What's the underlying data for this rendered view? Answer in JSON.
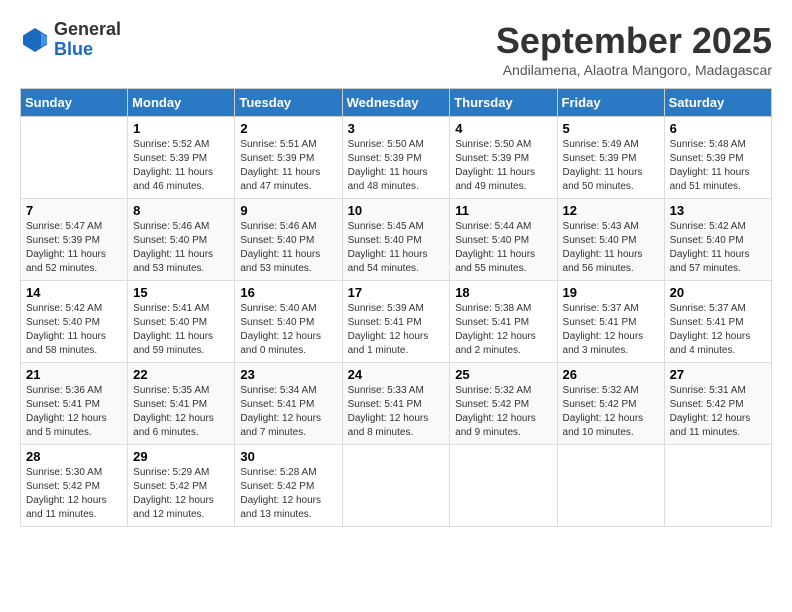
{
  "logo": {
    "general": "General",
    "blue": "Blue"
  },
  "title": "September 2025",
  "subtitle": "Andilamena, Alaotra Mangoro, Madagascar",
  "headers": [
    "Sunday",
    "Monday",
    "Tuesday",
    "Wednesday",
    "Thursday",
    "Friday",
    "Saturday"
  ],
  "weeks": [
    [
      {
        "day": "",
        "info": ""
      },
      {
        "day": "1",
        "info": "Sunrise: 5:52 AM\nSunset: 5:39 PM\nDaylight: 11 hours\nand 46 minutes."
      },
      {
        "day": "2",
        "info": "Sunrise: 5:51 AM\nSunset: 5:39 PM\nDaylight: 11 hours\nand 47 minutes."
      },
      {
        "day": "3",
        "info": "Sunrise: 5:50 AM\nSunset: 5:39 PM\nDaylight: 11 hours\nand 48 minutes."
      },
      {
        "day": "4",
        "info": "Sunrise: 5:50 AM\nSunset: 5:39 PM\nDaylight: 11 hours\nand 49 minutes."
      },
      {
        "day": "5",
        "info": "Sunrise: 5:49 AM\nSunset: 5:39 PM\nDaylight: 11 hours\nand 50 minutes."
      },
      {
        "day": "6",
        "info": "Sunrise: 5:48 AM\nSunset: 5:39 PM\nDaylight: 11 hours\nand 51 minutes."
      }
    ],
    [
      {
        "day": "7",
        "info": "Sunrise: 5:47 AM\nSunset: 5:39 PM\nDaylight: 11 hours\nand 52 minutes."
      },
      {
        "day": "8",
        "info": "Sunrise: 5:46 AM\nSunset: 5:40 PM\nDaylight: 11 hours\nand 53 minutes."
      },
      {
        "day": "9",
        "info": "Sunrise: 5:46 AM\nSunset: 5:40 PM\nDaylight: 11 hours\nand 53 minutes."
      },
      {
        "day": "10",
        "info": "Sunrise: 5:45 AM\nSunset: 5:40 PM\nDaylight: 11 hours\nand 54 minutes."
      },
      {
        "day": "11",
        "info": "Sunrise: 5:44 AM\nSunset: 5:40 PM\nDaylight: 11 hours\nand 55 minutes."
      },
      {
        "day": "12",
        "info": "Sunrise: 5:43 AM\nSunset: 5:40 PM\nDaylight: 11 hours\nand 56 minutes."
      },
      {
        "day": "13",
        "info": "Sunrise: 5:42 AM\nSunset: 5:40 PM\nDaylight: 11 hours\nand 57 minutes."
      }
    ],
    [
      {
        "day": "14",
        "info": "Sunrise: 5:42 AM\nSunset: 5:40 PM\nDaylight: 11 hours\nand 58 minutes."
      },
      {
        "day": "15",
        "info": "Sunrise: 5:41 AM\nSunset: 5:40 PM\nDaylight: 11 hours\nand 59 minutes."
      },
      {
        "day": "16",
        "info": "Sunrise: 5:40 AM\nSunset: 5:40 PM\nDaylight: 12 hours\nand 0 minutes."
      },
      {
        "day": "17",
        "info": "Sunrise: 5:39 AM\nSunset: 5:41 PM\nDaylight: 12 hours\nand 1 minute."
      },
      {
        "day": "18",
        "info": "Sunrise: 5:38 AM\nSunset: 5:41 PM\nDaylight: 12 hours\nand 2 minutes."
      },
      {
        "day": "19",
        "info": "Sunrise: 5:37 AM\nSunset: 5:41 PM\nDaylight: 12 hours\nand 3 minutes."
      },
      {
        "day": "20",
        "info": "Sunrise: 5:37 AM\nSunset: 5:41 PM\nDaylight: 12 hours\nand 4 minutes."
      }
    ],
    [
      {
        "day": "21",
        "info": "Sunrise: 5:36 AM\nSunset: 5:41 PM\nDaylight: 12 hours\nand 5 minutes."
      },
      {
        "day": "22",
        "info": "Sunrise: 5:35 AM\nSunset: 5:41 PM\nDaylight: 12 hours\nand 6 minutes."
      },
      {
        "day": "23",
        "info": "Sunrise: 5:34 AM\nSunset: 5:41 PM\nDaylight: 12 hours\nand 7 minutes."
      },
      {
        "day": "24",
        "info": "Sunrise: 5:33 AM\nSunset: 5:41 PM\nDaylight: 12 hours\nand 8 minutes."
      },
      {
        "day": "25",
        "info": "Sunrise: 5:32 AM\nSunset: 5:42 PM\nDaylight: 12 hours\nand 9 minutes."
      },
      {
        "day": "26",
        "info": "Sunrise: 5:32 AM\nSunset: 5:42 PM\nDaylight: 12 hours\nand 10 minutes."
      },
      {
        "day": "27",
        "info": "Sunrise: 5:31 AM\nSunset: 5:42 PM\nDaylight: 12 hours\nand 11 minutes."
      }
    ],
    [
      {
        "day": "28",
        "info": "Sunrise: 5:30 AM\nSunset: 5:42 PM\nDaylight: 12 hours\nand 11 minutes."
      },
      {
        "day": "29",
        "info": "Sunrise: 5:29 AM\nSunset: 5:42 PM\nDaylight: 12 hours\nand 12 minutes."
      },
      {
        "day": "30",
        "info": "Sunrise: 5:28 AM\nSunset: 5:42 PM\nDaylight: 12 hours\nand 13 minutes."
      },
      {
        "day": "",
        "info": ""
      },
      {
        "day": "",
        "info": ""
      },
      {
        "day": "",
        "info": ""
      },
      {
        "day": "",
        "info": ""
      }
    ]
  ]
}
